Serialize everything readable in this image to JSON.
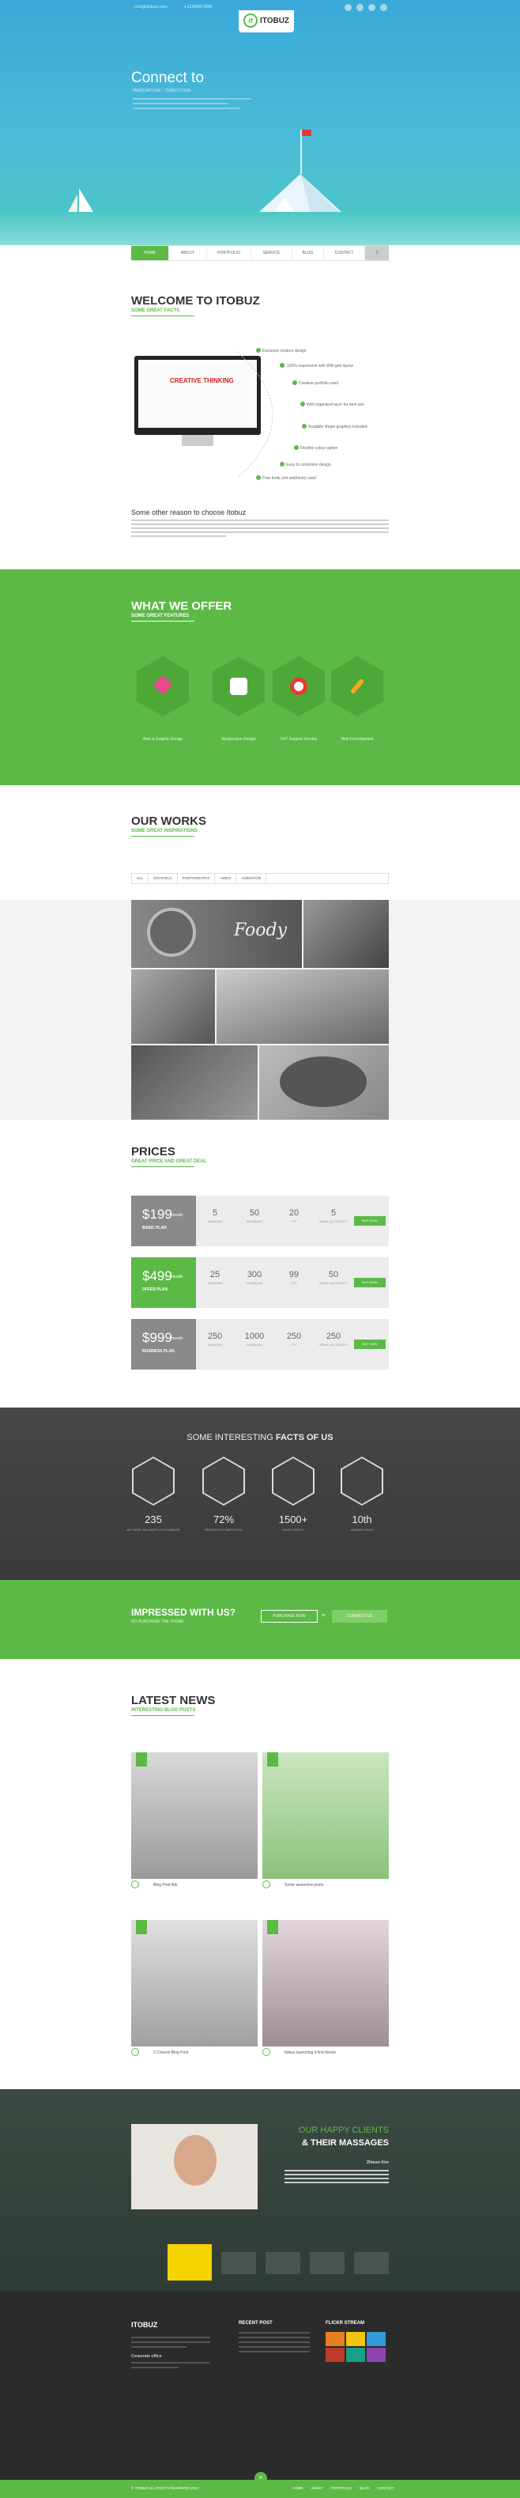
{
  "brand": {
    "name": "ITOBUZ",
    "mark": "it"
  },
  "topbar": {
    "email": "info@itobuz.com",
    "phone": "+1234567890"
  },
  "hero": {
    "title": "Connect to",
    "subtitle": "INNOVATION - DIRECTION"
  },
  "nav": {
    "items": [
      "HOME",
      "ABOUT",
      "PORTFOLIO",
      "SERVICE",
      "BLOG",
      "CONTACT"
    ],
    "active": 0
  },
  "welcome": {
    "title": "WELCOME TO ITOBUZ",
    "subtitle": "SOME GREAT FACTS",
    "features": [
      "Exclusive modern design",
      "100% responsive with Wiki grid layout",
      "Creative portfolio used",
      "Well organised layer for best use",
      "Scalable shape graphics included",
      "Flexible colour option",
      "Easy to customize design",
      "Free fonts (not webfonts) used"
    ],
    "reason_title": "Some other reason to choose Itobuz",
    "screen_text": "CREATIVE THINKING"
  },
  "offer": {
    "title": "WHAT WE OFFER",
    "subtitle": "SOME GREAT FEATURES",
    "items": [
      "Web & Graphic Design",
      "Responsive Design",
      "24/7 Support Service",
      "Web Development"
    ]
  },
  "works": {
    "title": "OUR WORKS",
    "subtitle": "SOME GREAT INSPIRATIONS",
    "filters": [
      "ALL",
      "GRAPHICS",
      "PHOTOGRAPHY",
      "VIDEO",
      "ANIMATION"
    ],
    "photo_text": "Foody"
  },
  "prices": {
    "title": "PRICES",
    "subtitle": "GREAT PRICE AND GREAT DEAL",
    "plans": [
      {
        "amount": "$199",
        "per": "/month",
        "name": "BASIC PLAN",
        "vals": [
          "5",
          "50",
          "20",
          "5"
        ],
        "labels": [
          "DOMAINS",
          "DATABASE",
          "FTP",
          "EMAIL ACCOUNTS"
        ],
        "button": "BUY NOW"
      },
      {
        "amount": "$499",
        "per": "/month",
        "name": "OFFER PLAN",
        "vals": [
          "25",
          "300",
          "99",
          "50"
        ],
        "labels": [
          "DOMAINS",
          "DATABASE",
          "FTP",
          "EMAIL ACCOUNTS"
        ],
        "button": "BUY NOW"
      },
      {
        "amount": "$999",
        "per": "/month",
        "name": "BUSINESS PLAN",
        "vals": [
          "250",
          "1000",
          "250",
          "250"
        ],
        "labels": [
          "DOMAINS",
          "DATABASE",
          "FTP",
          "EMAIL ACCOUNTS"
        ],
        "button": "BUY NOW"
      }
    ]
  },
  "facts": {
    "title_pre": "SOME INTERESTING ",
    "title_bold": "FACTS OF US",
    "items": [
      {
        "num": "235",
        "label": "WE HAVE 235 HAPPY CUSTOMERS"
      },
      {
        "num": "72%",
        "label": "PROJECTS COMPLETED"
      },
      {
        "num": "1500+",
        "label": "BLOG POSTS"
      },
      {
        "num": "10th",
        "label": "AWARDS WON"
      }
    ]
  },
  "impress": {
    "title": "IMPRESSED WITH US?",
    "subtitle": "SO PURCHASE THE THEME",
    "btn1": "PURCHASE NOW",
    "or": "or",
    "btn2": "CONTACT US"
  },
  "news": {
    "title": "LATEST NEWS",
    "subtitle": "INTERESTING BLOG POSTS",
    "posts": [
      {
        "title": "Blog Post title",
        "day": "15"
      },
      {
        "title": "Some awesome posts",
        "day": "15"
      },
      {
        "title": "2 Column Blog Post",
        "day": "15"
      },
      {
        "title": "Itobuz launching it first theme",
        "day": "15"
      }
    ]
  },
  "clients": {
    "title1": "OUR HAPPY CLIENTS",
    "title2": "& THEIR MASSAGES",
    "author": "Zhiwen Kim"
  },
  "footer": {
    "col2": "RECENT POST",
    "col3": "FLICKR STREAM",
    "address_title": "Corporate office"
  },
  "bottom": {
    "copyright": "© ITOBUZ ALL RIGHTS RESERVED 2014",
    "links": [
      "HOME",
      "ABOUT",
      "PORTFOLIO",
      "BLOG",
      "CONTACT"
    ]
  },
  "colors": {
    "green": "#5cb946",
    "dark": "#2b2b2b",
    "sky": "#3aa8d8"
  }
}
